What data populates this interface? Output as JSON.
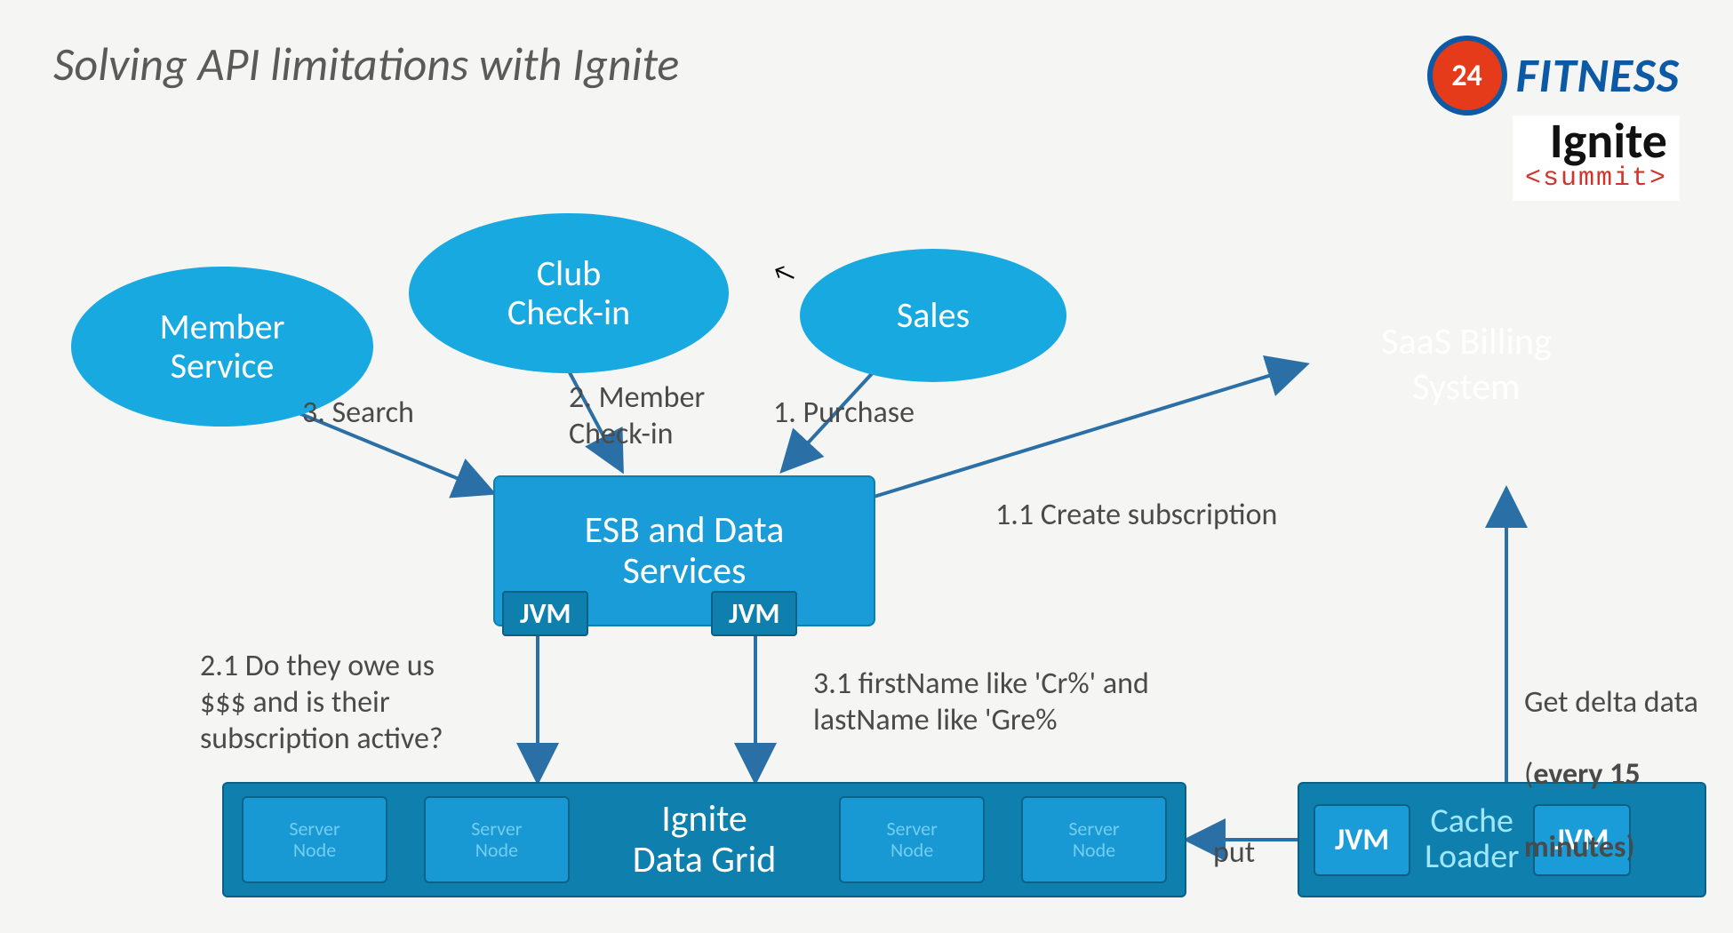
{
  "title": "Solving API limitations with Ignite",
  "logos": {
    "fitness_badge": "24",
    "fitness_text": "FITNESS",
    "ignite": "Ignite",
    "ignite_summit": "<summit>"
  },
  "nodes": {
    "member_service": "Member\nService",
    "club_checkin": "Club\nCheck-in",
    "sales": "Sales",
    "saas_cloud": "SaaS Billing\nSystem",
    "esb": "ESB and Data\nServices",
    "jvm": "JVM",
    "data_grid": "Ignite\nData Grid",
    "server_node": "Server\nNode",
    "cache_loader": "Cache\nLoader"
  },
  "edge_labels": {
    "purchase": "1. Purchase",
    "create_sub": "1.1 Create subscription",
    "member_checkin": "2. Member\nCheck-in",
    "owe": "2.1 Do they owe us\n$$$ and is their\nsubscription active?",
    "search": "3. Search",
    "like_query": "3.1 firstName like 'Cr%' and\nlastName like 'Gre%",
    "put": "put",
    "delta": "Get delta data\n(every 15\nminutes)"
  }
}
